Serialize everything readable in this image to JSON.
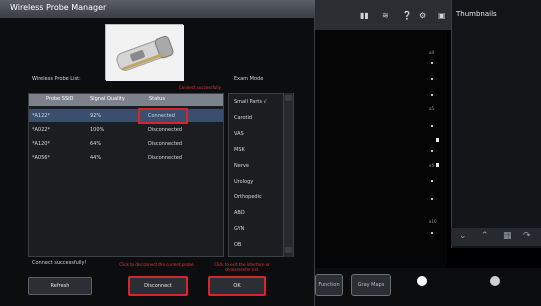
{
  "dialog": {
    "title": "Wireless Probe Manager",
    "probe_list_label": "Wireless Probe List:",
    "exam_mode_label": "Exam Mode",
    "connect_note": "Connect successfully!",
    "annotation_connected": "Connect successfully",
    "annotation_disconnect": "Click to disconnect the current probe.",
    "annotation_ok": "Click to exit the interface or choose/enter list.",
    "columns": [
      "Probe SSID",
      "Signal Quality",
      "Status"
    ],
    "rows": [
      {
        "ssid": "*A122*",
        "signal": "92%",
        "status": "Connected"
      },
      {
        "ssid": "*A022*",
        "signal": "100%",
        "status": "Disconnected"
      },
      {
        "ssid": "*A120*",
        "signal": "64%",
        "status": "Disconnected"
      },
      {
        "ssid": "*A056*",
        "signal": "44%",
        "status": "Disconnected"
      }
    ],
    "exam_modes": [
      "Small Parts √",
      "Carotid",
      "VAS",
      "MSK",
      "Nerve",
      "Urology",
      "Orthopedic",
      "ABD",
      "GYN",
      "OB"
    ],
    "buttons": {
      "refresh": "Refresh",
      "disconnect": "Disconnect",
      "ok": "OK"
    }
  },
  "background": {
    "thumbnails_title": "Thumbnails",
    "status_icons": [
      "battery-icon",
      "wifi-icon",
      "help-icon",
      "settings-icon",
      "monitor-icon"
    ],
    "depth_marks": [
      "a4",
      "a5",
      "e5",
      "a10"
    ],
    "bottom_buttons": [
      "Function",
      "Gray Maps"
    ]
  },
  "colors": {
    "highlight_red": "#d6262b",
    "selected_row": "#3a4f6e",
    "header": "#7c828b"
  }
}
